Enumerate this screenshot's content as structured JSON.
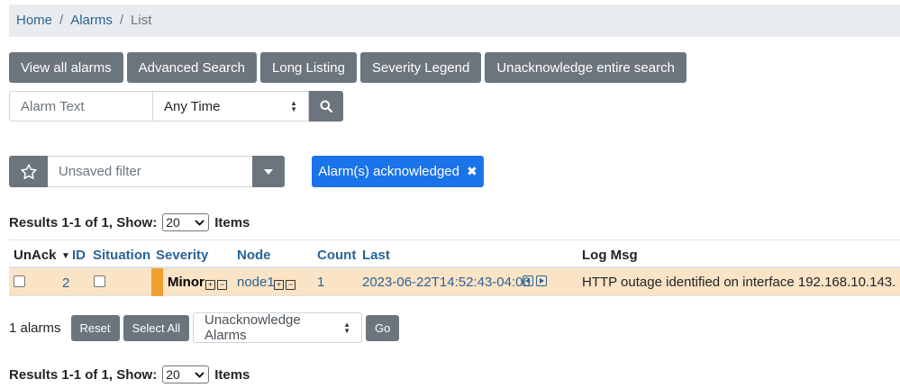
{
  "breadcrumb": {
    "home": "Home",
    "alarms": "Alarms",
    "current": "List",
    "separator": "/"
  },
  "toolbar": {
    "view_all": "View all alarms",
    "advanced_search": "Advanced Search",
    "long_listing": "Long Listing",
    "severity_legend": "Severity Legend",
    "unack_search": "Unacknowledge entire search"
  },
  "search": {
    "placeholder": "Alarm Text",
    "time_value": "Any Time",
    "button_icon": "search-icon"
  },
  "filter": {
    "placeholder": "Unsaved filter",
    "star_icon": "star-icon",
    "caret_icon": "caret-down-icon"
  },
  "chip": {
    "label": "Alarm(s) acknowledged",
    "close": "✖"
  },
  "results": {
    "text": "Results 1-1 of 1, Show:",
    "page_size": "20",
    "suffix": "Items"
  },
  "table": {
    "columns": [
      "UnAck",
      "ID",
      "Situation",
      "Severity",
      "Node",
      "Count",
      "Last",
      "Log Msg"
    ],
    "sort_indicator": "▼",
    "rows": [
      {
        "id": "2",
        "severity": "Minor",
        "severity_color": "#f0a030",
        "node": "node1",
        "count": "1",
        "last": "2023-06-22T14:52:43-04:00",
        "log_msg": "HTTP outage identified on interface 192.168.10.143."
      }
    ]
  },
  "actions": {
    "count": "1 alarms",
    "reset": "Reset",
    "select_all": "Select All",
    "action_value": "Unacknowledge Alarms",
    "go": "Go"
  },
  "colors": {
    "gray": "#6c757d",
    "primary": "#1a73e8",
    "row_bg": "#fbe3c5",
    "link": "#2a6496"
  }
}
